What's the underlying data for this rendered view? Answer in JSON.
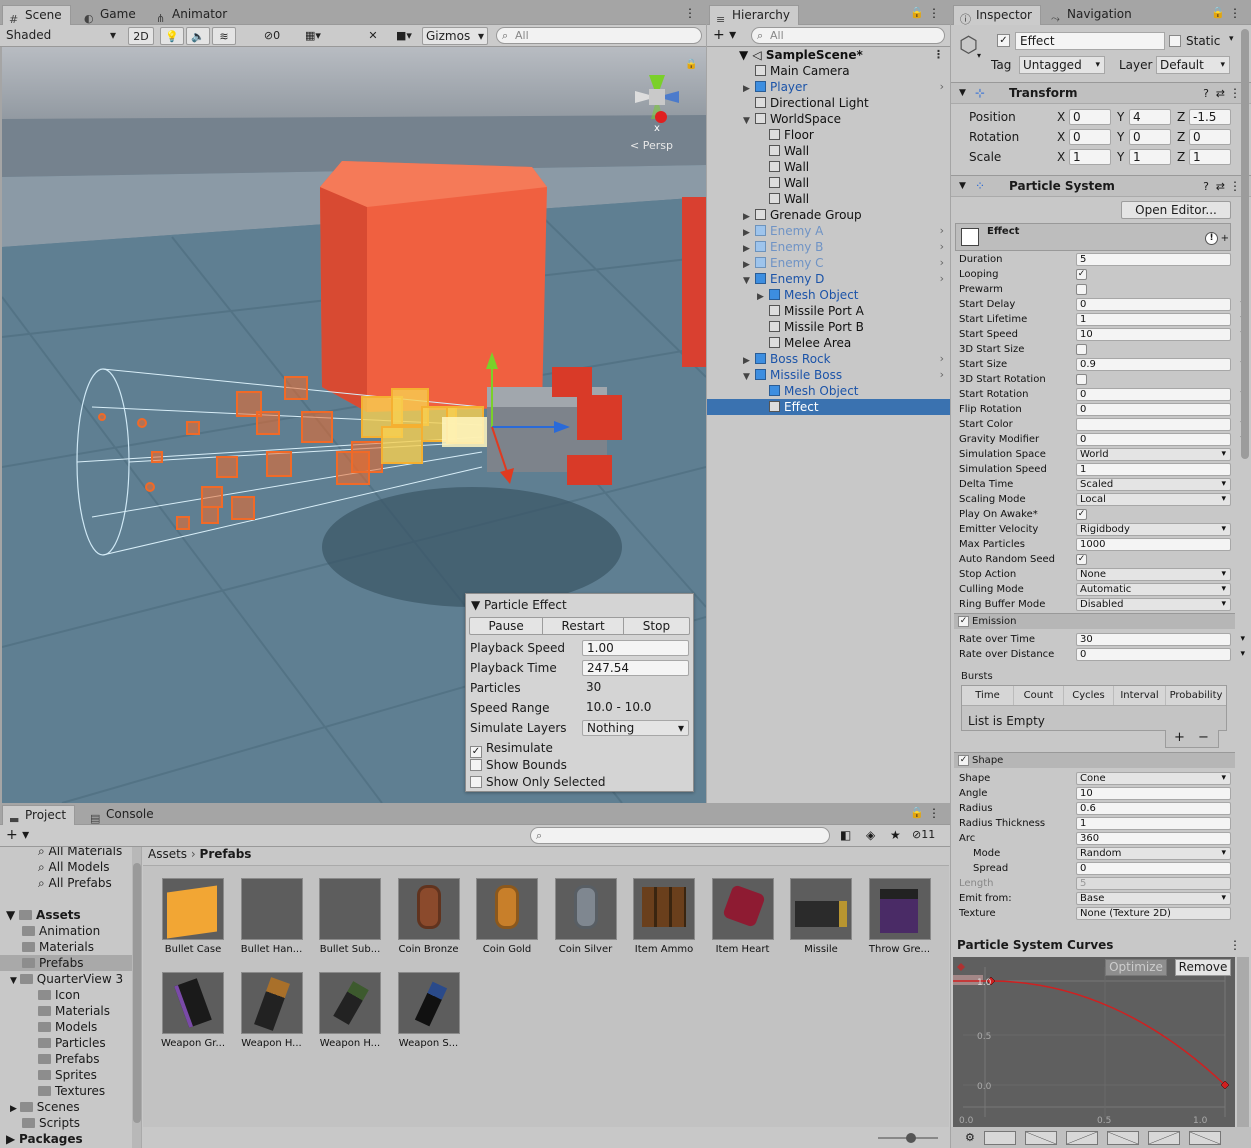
{
  "scene_tabs": {
    "scene": "Scene",
    "game": "Game",
    "animator": "Animator"
  },
  "scene_toolbar": {
    "shading": "Shaded",
    "mode2d": "2D",
    "hidden_count": "0",
    "gizmos": "Gizmos",
    "search_placeholder": "All",
    "persp": "Persp",
    "axis_x": "x"
  },
  "particle_effect": {
    "title": "Particle Effect",
    "pause": "Pause",
    "restart": "Restart",
    "stop": "Stop",
    "rows": [
      {
        "label": "Playback Speed",
        "value": "1.00"
      },
      {
        "label": "Playback Time",
        "value": "247.54"
      },
      {
        "label": "Particles",
        "value": "30"
      },
      {
        "label": "Speed Range",
        "value": "10.0 - 10.0"
      },
      {
        "label": "Simulate Layers",
        "value": "Nothing"
      }
    ],
    "checks": [
      {
        "label": "Resimulate",
        "checked": "✓"
      },
      {
        "label": "Show Bounds",
        "checked": ""
      },
      {
        "label": "Show Only Selected",
        "checked": ""
      }
    ]
  },
  "hierarchy": {
    "tab": "Hierarchy",
    "search_placeholder": "All",
    "scene_name": "SampleScene*",
    "items": [
      {
        "label": "Main Camera",
        "indent": 1,
        "arrow": "",
        "kind": "go",
        "nav": ""
      },
      {
        "label": "Player",
        "indent": 1,
        "arrow": "▶",
        "kind": "prefab",
        "nav": "›"
      },
      {
        "label": "Directional Light",
        "indent": 1,
        "arrow": "",
        "kind": "go",
        "nav": ""
      },
      {
        "label": "WorldSpace",
        "indent": 1,
        "arrow": "▼",
        "kind": "go",
        "nav": ""
      },
      {
        "label": "Floor",
        "indent": 2,
        "arrow": "",
        "kind": "go",
        "nav": ""
      },
      {
        "label": "Wall",
        "indent": 2,
        "arrow": "",
        "kind": "go",
        "nav": ""
      },
      {
        "label": "Wall",
        "indent": 2,
        "arrow": "",
        "kind": "go",
        "nav": ""
      },
      {
        "label": "Wall",
        "indent": 2,
        "arrow": "",
        "kind": "go",
        "nav": ""
      },
      {
        "label": "Wall",
        "indent": 2,
        "arrow": "",
        "kind": "go",
        "nav": ""
      },
      {
        "label": "Grenade Group",
        "indent": 1,
        "arrow": "▶",
        "kind": "go",
        "nav": ""
      },
      {
        "label": "Enemy A",
        "indent": 1,
        "arrow": "▶",
        "kind": "prefab-dim",
        "nav": "›"
      },
      {
        "label": "Enemy B",
        "indent": 1,
        "arrow": "▶",
        "kind": "prefab-dim",
        "nav": "›"
      },
      {
        "label": "Enemy C",
        "indent": 1,
        "arrow": "▶",
        "kind": "prefab-dim",
        "nav": "›"
      },
      {
        "label": "Enemy D",
        "indent": 1,
        "arrow": "▼",
        "kind": "prefab",
        "nav": "›"
      },
      {
        "label": "Mesh Object",
        "indent": 2,
        "arrow": "▶",
        "kind": "prefab",
        "nav": ""
      },
      {
        "label": "Missile Port A",
        "indent": 2,
        "arrow": "",
        "kind": "go",
        "nav": ""
      },
      {
        "label": "Missile Port B",
        "indent": 2,
        "arrow": "",
        "kind": "go",
        "nav": ""
      },
      {
        "label": "Melee Area",
        "indent": 2,
        "arrow": "",
        "kind": "go",
        "nav": ""
      },
      {
        "label": "Boss Rock",
        "indent": 1,
        "arrow": "▶",
        "kind": "prefab",
        "nav": "›"
      },
      {
        "label": "Missile Boss",
        "indent": 1,
        "arrow": "▼",
        "kind": "prefab",
        "nav": "›"
      },
      {
        "label": "Mesh Object",
        "indent": 2,
        "arrow": "",
        "kind": "prefab",
        "nav": ""
      },
      {
        "label": "Effect",
        "indent": 2,
        "arrow": "",
        "kind": "sel",
        "nav": ""
      }
    ]
  },
  "inspector": {
    "tab": "Inspector",
    "tab2": "Navigation",
    "name": "Effect",
    "static": "Static",
    "tag_label": "Tag",
    "tag": "Untagged",
    "layer_label": "Layer",
    "layer": "Default",
    "transform": {
      "title": "Transform",
      "rows": [
        {
          "label": "Position",
          "x": "0",
          "y": "4",
          "z": "-1.5"
        },
        {
          "label": "Rotation",
          "x": "0",
          "y": "0",
          "z": "0"
        },
        {
          "label": "Scale",
          "x": "1",
          "y": "1",
          "z": "1"
        }
      ]
    },
    "ps_title": "Particle System",
    "open_editor": "Open Editor...",
    "effect_label": "Effect",
    "main": [
      {
        "label": "Duration",
        "type": "f",
        "value": "5"
      },
      {
        "label": "Looping",
        "type": "c",
        "value": "✓"
      },
      {
        "label": "Prewarm",
        "type": "c",
        "value": ""
      },
      {
        "label": "Start Delay",
        "type": "fs",
        "value": "0"
      },
      {
        "label": "Start Lifetime",
        "type": "fs",
        "value": "1"
      },
      {
        "label": "Start Speed",
        "type": "fs",
        "value": "10"
      },
      {
        "label": "3D Start Size",
        "type": "c",
        "value": ""
      },
      {
        "label": "Start Size",
        "type": "fs",
        "value": "0.9"
      },
      {
        "label": "3D Start Rotation",
        "type": "c",
        "value": ""
      },
      {
        "label": "Start Rotation",
        "type": "fs",
        "value": "0"
      },
      {
        "label": "Flip Rotation",
        "type": "f",
        "value": "0"
      },
      {
        "label": "Start Color",
        "type": "fs",
        "value": ""
      },
      {
        "label": "Gravity Modifier",
        "type": "fs",
        "value": "0"
      },
      {
        "label": "Simulation Space",
        "type": "d",
        "value": "World"
      },
      {
        "label": "Simulation Speed",
        "type": "f",
        "value": "1"
      },
      {
        "label": "Delta Time",
        "type": "d",
        "value": "Scaled"
      },
      {
        "label": "Scaling Mode",
        "type": "d",
        "value": "Local"
      },
      {
        "label": "Play On Awake*",
        "type": "c",
        "value": "✓"
      },
      {
        "label": "Emitter Velocity",
        "type": "d",
        "value": "Rigidbody"
      },
      {
        "label": "Max Particles",
        "type": "f",
        "value": "1000"
      },
      {
        "label": "Auto Random Seed",
        "type": "c",
        "value": "✓"
      },
      {
        "label": "Stop Action",
        "type": "d",
        "value": "None"
      },
      {
        "label": "Culling Mode",
        "type": "d",
        "value": "Automatic"
      },
      {
        "label": "Ring Buffer Mode",
        "type": "d",
        "value": "Disabled"
      }
    ],
    "emission": {
      "title": "Emission",
      "rate_time_label": "Rate over Time",
      "rate_time": "30",
      "rate_dist_label": "Rate over Distance",
      "rate_dist": "0",
      "bursts_label": "Bursts",
      "cols": [
        "Time",
        "Count",
        "Cycles",
        "Interval",
        "Probability"
      ],
      "empty": "List is Empty",
      "add": "+",
      "remove": "−"
    },
    "shape": {
      "title": "Shape",
      "rows": [
        {
          "label": "Shape",
          "type": "d",
          "value": "Cone",
          "dim": false
        },
        {
          "label": "Angle",
          "type": "f",
          "value": "10",
          "dim": false
        },
        {
          "label": "Radius",
          "type": "f",
          "value": "0.6",
          "dim": false
        },
        {
          "label": "Radius Thickness",
          "type": "f",
          "value": "1",
          "dim": false
        },
        {
          "label": "Arc",
          "type": "f",
          "value": "360",
          "dim": false
        },
        {
          "label": "Mode",
          "type": "d",
          "value": "Random",
          "dim": false,
          "sub": true
        },
        {
          "label": "Spread",
          "type": "f",
          "value": "0",
          "dim": false,
          "sub": true
        },
        {
          "label": "Length",
          "type": "f",
          "value": "5",
          "dim": true
        },
        {
          "label": "Emit from:",
          "type": "d",
          "value": "Base",
          "dim": false
        },
        {
          "label": "Texture",
          "type": "t",
          "value": "None (Texture 2D)",
          "dim": false
        }
      ]
    }
  },
  "curves": {
    "title": "Particle System Curves",
    "optimize": "Optimize",
    "remove": "Remove",
    "y_top": "1.0",
    "y_mid": "0.5",
    "y_bot": "0.0",
    "x0": "0.0",
    "x_mid": "0.5",
    "x1": "1.0"
  },
  "project": {
    "tab": "Project",
    "tab2": "Console",
    "hidden_count": "11",
    "breadcrumb_root": "Assets",
    "breadcrumb_current": "Prefabs",
    "tree": [
      {
        "label": "All Materials",
        "indent": 2,
        "type": "search"
      },
      {
        "label": "All Models",
        "indent": 2,
        "type": "search"
      },
      {
        "label": "All Prefabs",
        "indent": 2,
        "type": "search"
      },
      {
        "label": "",
        "indent": 0,
        "type": "gap"
      },
      {
        "label": "Assets",
        "indent": 0,
        "type": "bold"
      },
      {
        "label": "Animation",
        "indent": 1,
        "type": "folder"
      },
      {
        "label": "Materials",
        "indent": 1,
        "type": "folder"
      },
      {
        "label": "Prefabs",
        "indent": 1,
        "type": "folder-sel"
      },
      {
        "label": "QuarterView 3",
        "indent": 1,
        "type": "folder-open"
      },
      {
        "label": "Icon",
        "indent": 2,
        "type": "folder"
      },
      {
        "label": "Materials",
        "indent": 2,
        "type": "folder"
      },
      {
        "label": "Models",
        "indent": 2,
        "type": "folder"
      },
      {
        "label": "Particles",
        "indent": 2,
        "type": "folder"
      },
      {
        "label": "Prefabs",
        "indent": 2,
        "type": "folder"
      },
      {
        "label": "Sprites",
        "indent": 2,
        "type": "folder"
      },
      {
        "label": "Textures",
        "indent": 2,
        "type": "folder"
      },
      {
        "label": "Scenes",
        "indent": 1,
        "type": "folder-c"
      },
      {
        "label": "Scripts",
        "indent": 1,
        "type": "folder"
      },
      {
        "label": "Packages",
        "indent": 0,
        "type": "bold-c"
      }
    ],
    "assets": [
      {
        "label": "Bullet Case",
        "color": "#f2a634",
        "shape": "cube"
      },
      {
        "label": "Bullet Han...",
        "color": "#5d5d5d",
        "shape": "none"
      },
      {
        "label": "Bullet Sub...",
        "color": "#5d5d5d",
        "shape": "none"
      },
      {
        "label": "Coin Bronze",
        "color": "#8b4a2c",
        "shape": "coin"
      },
      {
        "label": "Coin Gold",
        "color": "#c87f2a",
        "shape": "coin"
      },
      {
        "label": "Coin Silver",
        "color": "#7f8790",
        "shape": "coin"
      },
      {
        "label": "Item Ammo",
        "color": "#6a3f1c",
        "shape": "ammo"
      },
      {
        "label": "Item Heart",
        "color": "#8e1b32",
        "shape": "heart"
      },
      {
        "label": "Missile",
        "color": "#2b2b2b",
        "shape": "missile"
      },
      {
        "label": "Throw Gre...",
        "color": "#4a2b66",
        "shape": "grenade"
      },
      {
        "label": "Weapon Gr...",
        "color": "#2b2340",
        "shape": "grenade2"
      },
      {
        "label": "Weapon H...",
        "color": "#a9702a",
        "shape": "hammer"
      },
      {
        "label": "Weapon H...",
        "color": "#2e3a2a",
        "shape": "gun"
      },
      {
        "label": "Weapon S...",
        "color": "#243a66",
        "shape": "gun2"
      }
    ]
  }
}
